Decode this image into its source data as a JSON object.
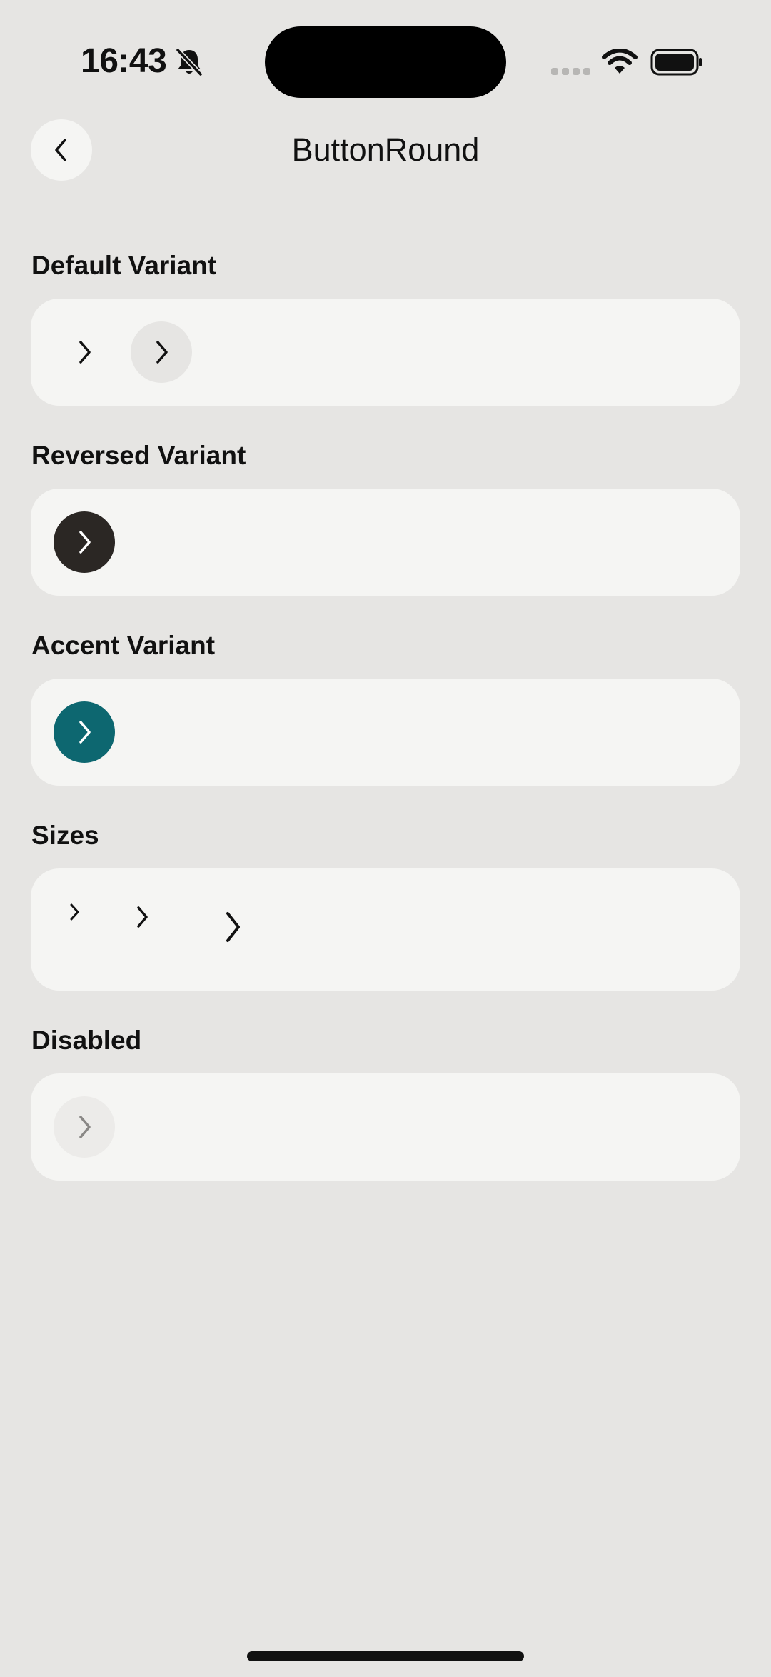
{
  "status_bar": {
    "time": "16:43",
    "icons": [
      "bell-slash-icon",
      "signal-icon",
      "wifi-icon",
      "battery-icon"
    ]
  },
  "nav": {
    "title": "ButtonRound",
    "back_icon": "chevron-left-icon"
  },
  "sections": [
    {
      "title": "Default Variant",
      "buttons": [
        "default-plain",
        "default-filled"
      ]
    },
    {
      "title": "Reversed Variant",
      "buttons": [
        "reversed"
      ]
    },
    {
      "title": "Accent Variant",
      "buttons": [
        "accent"
      ]
    },
    {
      "title": "Sizes",
      "buttons": [
        "small",
        "medium",
        "large"
      ]
    },
    {
      "title": "Disabled",
      "buttons": [
        "disabled"
      ]
    }
  ],
  "colors": {
    "background": "#e6e5e3",
    "card": "#f5f5f3",
    "default_fill": "#e6e5e3",
    "reversed_fill": "#2b2724",
    "accent_fill": "#0d6770",
    "disabled_fill": "#ecebe9",
    "disabled_icon": "#8a8886"
  }
}
